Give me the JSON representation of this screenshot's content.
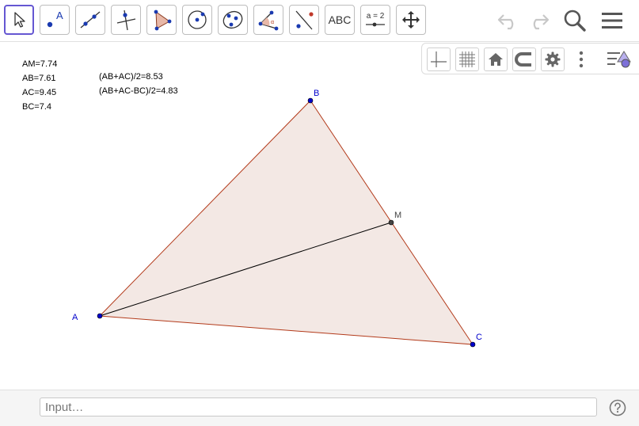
{
  "toolbar": {
    "tools": [
      {
        "name": "move-tool"
      },
      {
        "name": "point-tool",
        "label": "A"
      },
      {
        "name": "line-tool"
      },
      {
        "name": "perpendicular-line-tool"
      },
      {
        "name": "polygon-tool"
      },
      {
        "name": "circle-tool"
      },
      {
        "name": "conic-tool"
      },
      {
        "name": "angle-tool"
      },
      {
        "name": "reflect-tool"
      },
      {
        "name": "text-tool",
        "label": "ABC"
      },
      {
        "name": "slider-tool",
        "label": "a = 2"
      },
      {
        "name": "move-graphics-view-tool"
      }
    ],
    "right_actions": [
      "undo-icon",
      "redo-icon",
      "search-icon",
      "menu-icon"
    ]
  },
  "style_bar": {
    "buttons": [
      "axes-icon",
      "grid-icon",
      "home-icon",
      "point-capturing-icon",
      "settings-icon",
      "more-options-icon",
      "style-bar-toggle-icon"
    ]
  },
  "measurements": {
    "left": [
      "AM=7.74",
      "AB=7.61",
      "AC=9.45",
      "BC=7.4"
    ],
    "right": [
      "(AB+AC)/2=8.53",
      "(AB+AC-BC)/2=4.83"
    ]
  },
  "geometry": {
    "points": [
      {
        "label": "A",
        "color": "#0000cc"
      },
      {
        "label": "B",
        "color": "#0000cc"
      },
      {
        "label": "C",
        "color": "#0000cc"
      },
      {
        "label": "M",
        "color": "#444444"
      }
    ],
    "triangle": {
      "fill": "#f3e8e4",
      "stroke": "#b33a1a"
    },
    "median": {
      "from": "A",
      "to": "M",
      "stroke": "#000000"
    }
  },
  "input": {
    "placeholder": "Input…"
  },
  "colors": {
    "accent": "#6557d2"
  }
}
